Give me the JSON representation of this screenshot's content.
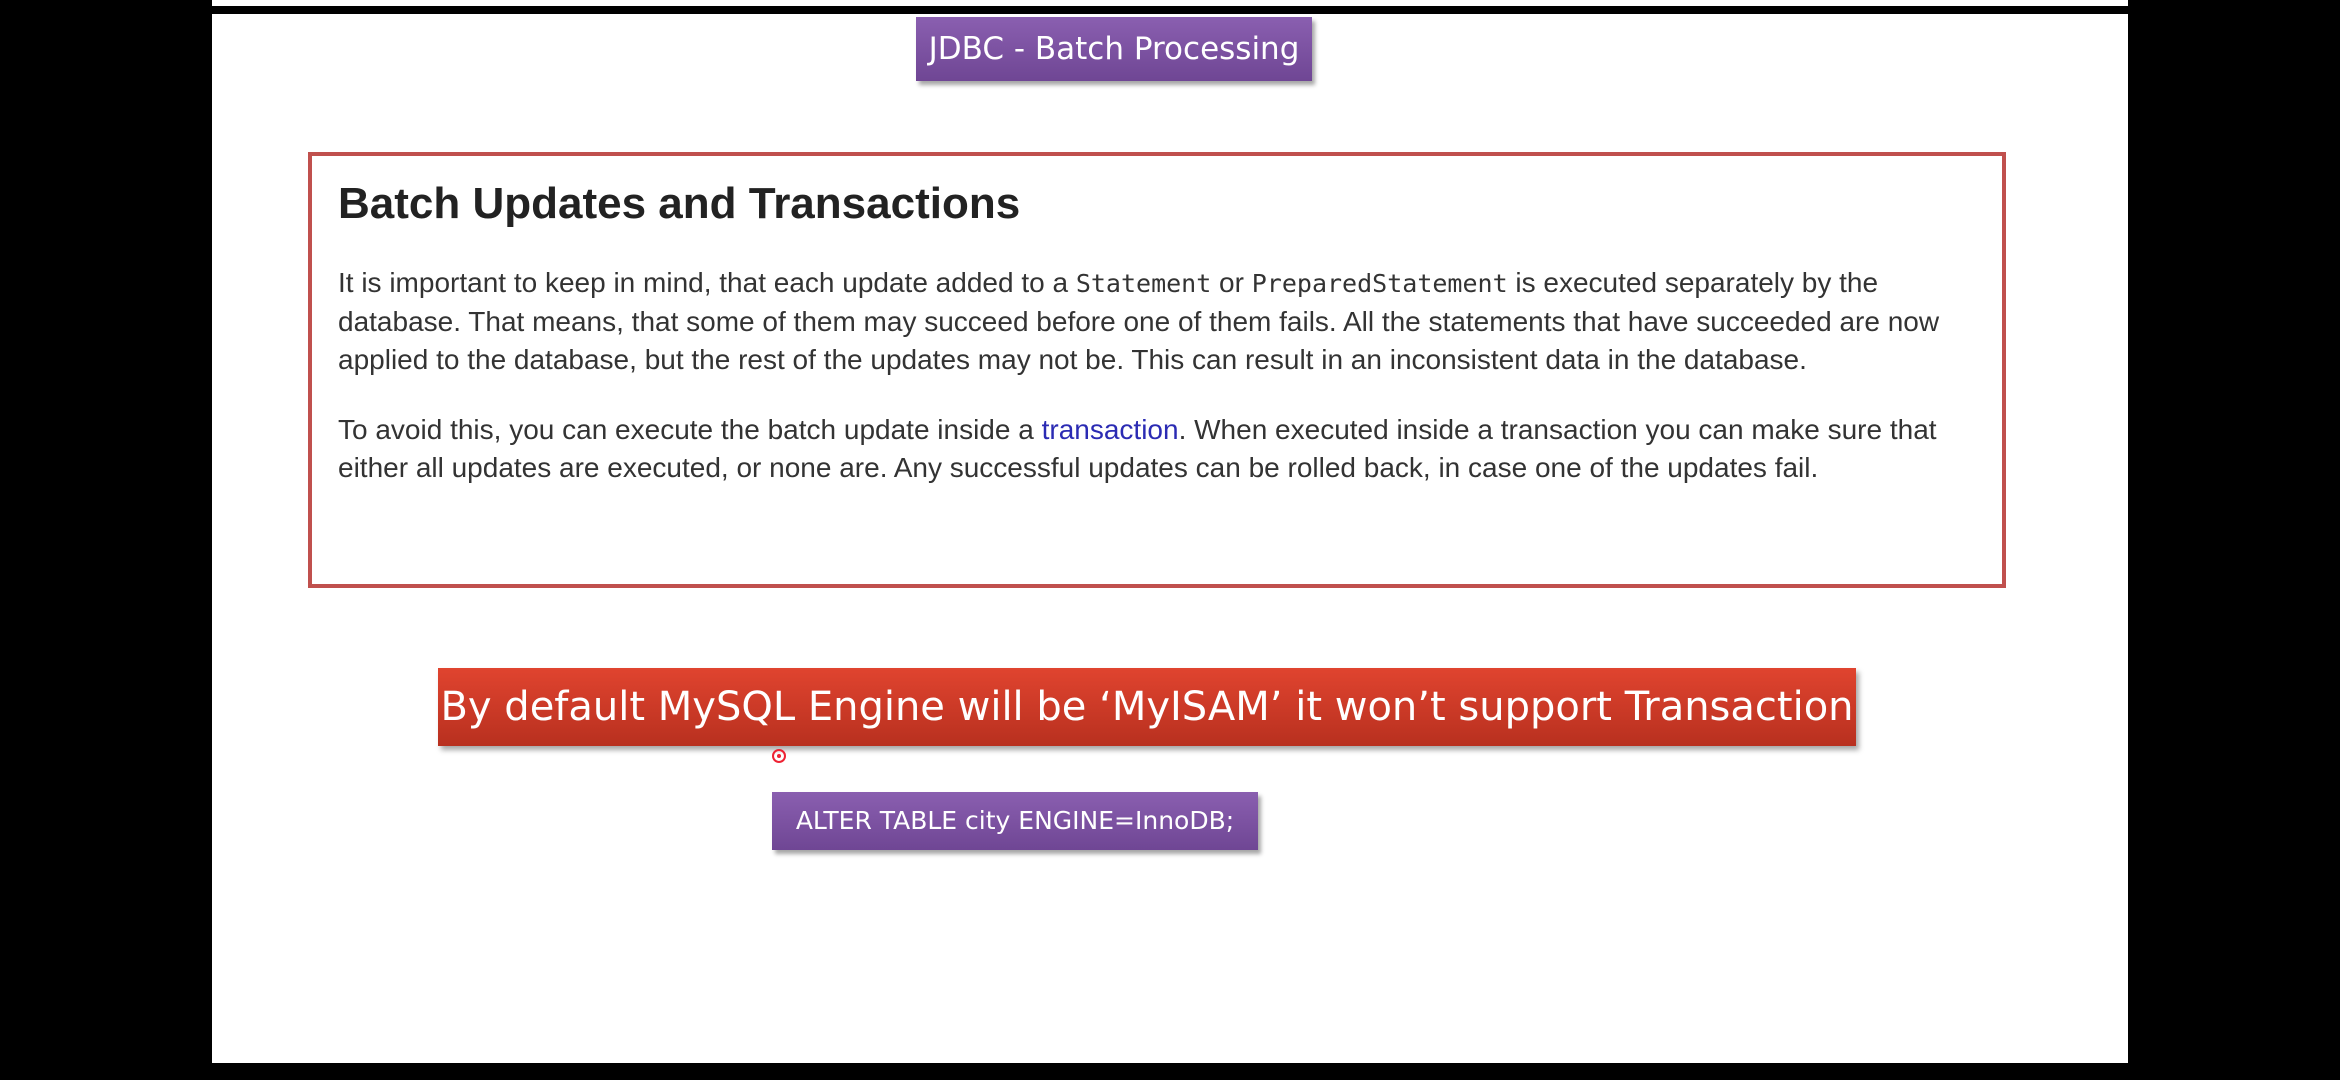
{
  "slide": {
    "title": "JDBC - Batch Processing"
  },
  "article": {
    "heading": "Batch Updates and Transactions",
    "para1": {
      "text_a": "It is important to keep in mind, that each update added to a ",
      "code_a": "Statement",
      "text_b": " or ",
      "code_b": "PreparedStatement",
      "text_c": " is executed separately by the database. That means, that some of them may succeed before one of them fails. All the statements that have succeeded are now applied to the database, but the rest of the updates may not be. This can result in an inconsistent data in the database."
    },
    "para2": {
      "text_a": "To avoid this, you can execute the batch update inside a ",
      "link": "transaction",
      "text_b": ". When executed inside a transaction you can make sure that either all updates are executed, or none are. Any successful updates can be rolled back, in case one of the updates fail."
    }
  },
  "banner": {
    "text": "By default MySQL Engine will be ‘MyISAM’ it won’t support Transaction"
  },
  "sql": {
    "text": "ALTER TABLE city ENGINE=InnoDB;"
  },
  "colors": {
    "purple_badge": "#7b519f",
    "red_banner": "#c9382a",
    "box_border": "#c0504d",
    "link": "#2b2bb3"
  }
}
